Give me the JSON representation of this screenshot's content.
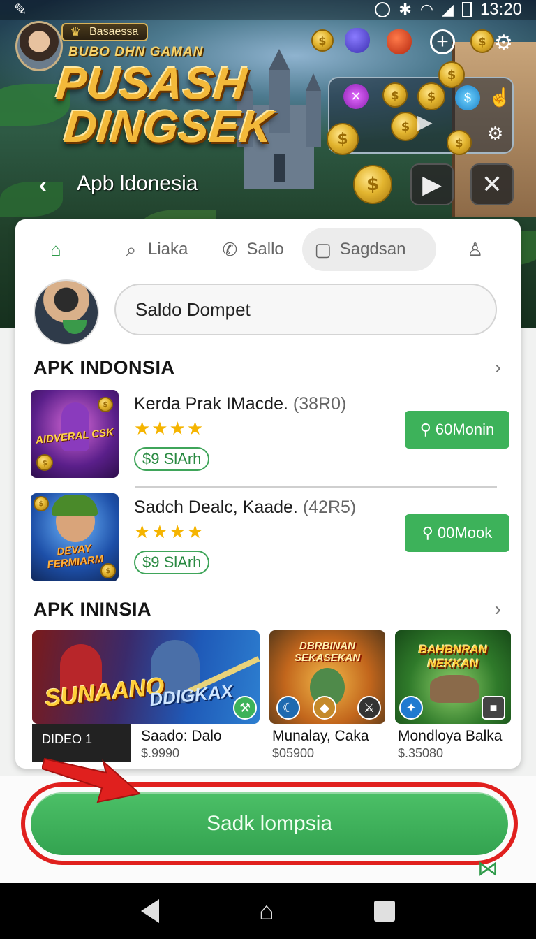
{
  "status_bar": {
    "time": "13:20"
  },
  "game_header": {
    "badge": "Basaessa",
    "subtitle": "BUBO DHN GAMAN",
    "title_line1": "PUSASH",
    "title_line2": "DINGSEK"
  },
  "nav": {
    "back": "‹",
    "title": "Apb ldonesia"
  },
  "tabs": [
    {
      "label": "",
      "icon": "home-icon"
    },
    {
      "label": "Liaka",
      "icon": "search-icon"
    },
    {
      "label": "Sallo",
      "icon": "chat-icon"
    },
    {
      "label": "Sagdsan",
      "icon": "message-icon"
    },
    {
      "label": "",
      "icon": "profile-icon"
    }
  ],
  "wallet": {
    "value": "Saldo Dompet"
  },
  "section1": {
    "title": "APK INDONSIA"
  },
  "apps": [
    {
      "name": "Kerda Prak IMacde.",
      "count": "(38R0)",
      "stars": "★★★★",
      "price": "$9 SlArh",
      "button": "60Monin",
      "thumb_text": "AIDVERAL CSK"
    },
    {
      "name": "Sadch Dealc, Kaade.",
      "count": "(42R5)",
      "stars": "★★★★",
      "price": "$9 SlArh",
      "button": "00Mook",
      "thumb_text": "DEVAY FERMIARM"
    }
  ],
  "section2": {
    "title": "APK ININSIA"
  },
  "games": [
    {
      "name": "Saado: Dalo",
      "price": "$.9990",
      "art_text1": "SUNAANO",
      "art_text2": "DDIGKAX",
      "tag": "DIDEO 1"
    },
    {
      "name": "Munalay, Caka",
      "price": "$05900",
      "art_text1": "DBRBINAN SEKASEKAN"
    },
    {
      "name": "Mondloya Balka",
      "price": "$.35080",
      "art_text1": "BAHBNRAN NEKKAN"
    }
  ],
  "cta": {
    "label": "Sadk lompsia"
  },
  "colors": {
    "accent_green": "#3db25a",
    "highlight_red": "#e0201e",
    "star": "#f5b400"
  }
}
